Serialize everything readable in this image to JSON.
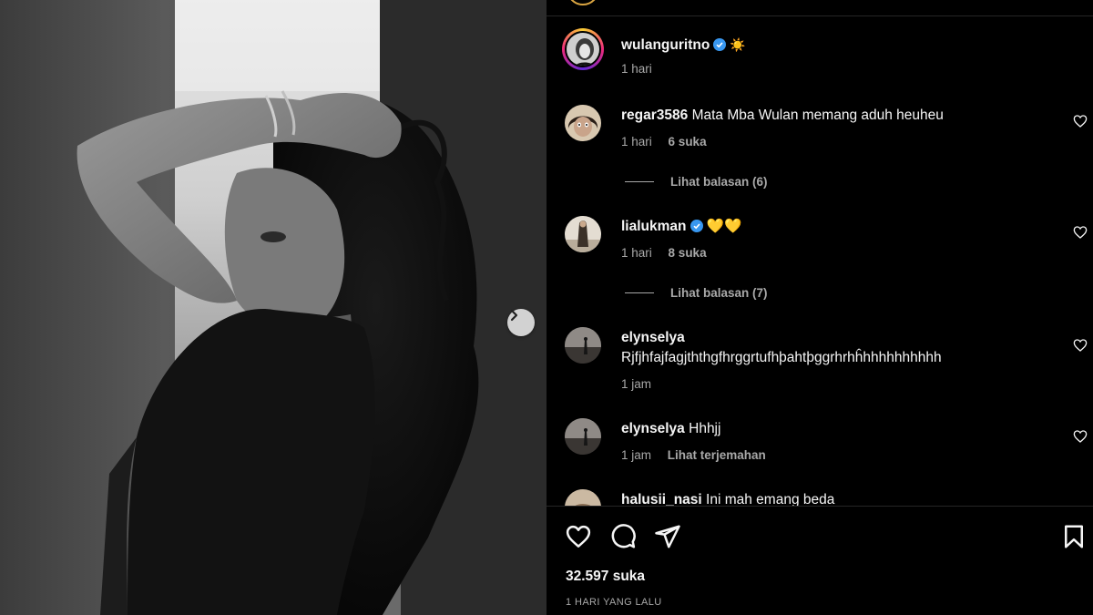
{
  "post": {
    "author": {
      "username": "wulanguritno",
      "verified": true,
      "emoji": "☀️",
      "time": "1 hari"
    },
    "likes": "32.597 suka",
    "date": "1 HARI YANG LALU"
  },
  "comments": [
    {
      "username": "regar3586",
      "verified": false,
      "text": "Mata Mba Wulan memang aduh heuheu",
      "time": "1 hari",
      "likes": "6 suka",
      "replies": "Lihat balasan (6)"
    },
    {
      "username": "lialukman",
      "verified": true,
      "text": "💛💛",
      "time": "1 hari",
      "likes": "8 suka",
      "replies": "Lihat balasan (7)"
    },
    {
      "username": "elynselya",
      "verified": false,
      "text": "Rjfjhfajfagjththgfhrggrtufhþahtþggrhrhĥhhhhhhhhhh",
      "time": "1 jam"
    },
    {
      "username": "elynselya",
      "verified": false,
      "text": "Hhhjj",
      "time": "1 jam",
      "translate": "Lihat terjemahan"
    },
    {
      "username": "halusii_nasi",
      "verified": false,
      "text": "Ini mah emang beda"
    }
  ],
  "colors": {
    "background": "#000000",
    "text_primary": "#f5f5f5",
    "text_secondary": "#a8a8a8",
    "verified_blue": "#3897f0",
    "divider": "#262626"
  },
  "icons": {
    "like": "heart-icon",
    "comment": "comment-icon",
    "share": "share-icon",
    "save": "bookmark-icon",
    "next": "chevron-right-icon"
  }
}
